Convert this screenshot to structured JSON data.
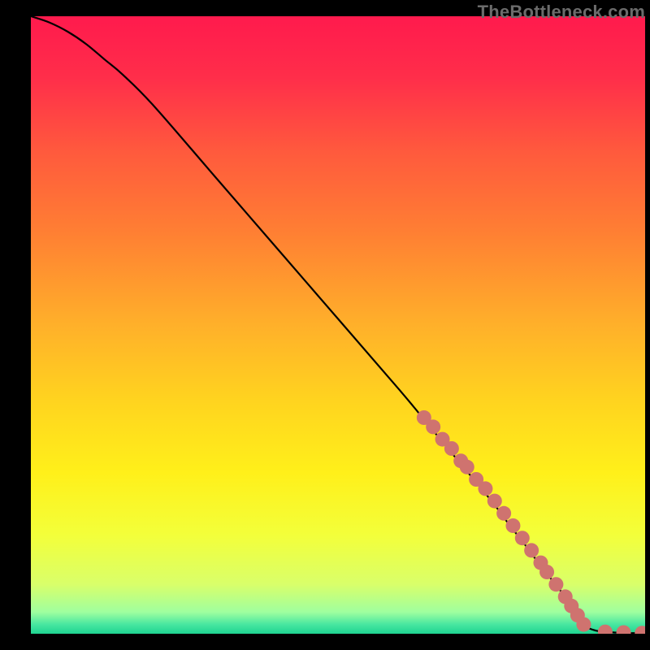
{
  "watermark": "TheBottleneck.com",
  "colors": {
    "background_black": "#000000",
    "gradient_stops": [
      {
        "offset": 0.0,
        "color": "#ff1a4d"
      },
      {
        "offset": 0.1,
        "color": "#ff2e4a"
      },
      {
        "offset": 0.22,
        "color": "#ff5a3d"
      },
      {
        "offset": 0.35,
        "color": "#ff7f33"
      },
      {
        "offset": 0.5,
        "color": "#ffb02a"
      },
      {
        "offset": 0.62,
        "color": "#ffd31f"
      },
      {
        "offset": 0.74,
        "color": "#fff01a"
      },
      {
        "offset": 0.84,
        "color": "#f3ff3a"
      },
      {
        "offset": 0.92,
        "color": "#d9ff6a"
      },
      {
        "offset": 0.965,
        "color": "#9fff9f"
      },
      {
        "offset": 0.985,
        "color": "#47e6a0"
      },
      {
        "offset": 1.0,
        "color": "#1fd491"
      }
    ],
    "curve": "#000000",
    "marker_fill": "#cf736f",
    "marker_stroke": "#b85f5c"
  },
  "chart_data": {
    "type": "line",
    "title": "",
    "xlabel": "",
    "ylabel": "",
    "xlim": [
      0,
      100
    ],
    "ylim": [
      0,
      100
    ],
    "grid": false,
    "series": [
      {
        "name": "curve",
        "x": [
          0,
          3,
          6,
          9,
          12,
          15,
          20,
          30,
          40,
          50,
          60,
          65,
          70,
          75,
          78,
          80,
          83,
          85,
          87,
          89,
          90,
          92,
          95,
          98,
          100
        ],
        "y": [
          100,
          99,
          97.5,
          95.5,
          93,
          90.5,
          85.5,
          74,
          62.5,
          51,
          39.5,
          33.5,
          27.5,
          21.5,
          17.5,
          15,
          11,
          8.5,
          6,
          3.5,
          1.5,
          0.5,
          0.2,
          0.1,
          0.1
        ]
      }
    ],
    "markers": {
      "name": "highlighted-points",
      "x": [
        64,
        65.5,
        67,
        68.5,
        70,
        71,
        72.5,
        74,
        75.5,
        77,
        78.5,
        80,
        81.5,
        83,
        84,
        85.5,
        87,
        88,
        89,
        90,
        93.5,
        96.5,
        99.5
      ],
      "y": [
        35,
        33.5,
        31.5,
        30,
        28,
        27,
        25,
        23.5,
        21.5,
        19.5,
        17.5,
        15.5,
        13.5,
        11.5,
        10,
        8,
        6,
        4.5,
        3,
        1.5,
        0.3,
        0.2,
        0.1
      ]
    }
  }
}
